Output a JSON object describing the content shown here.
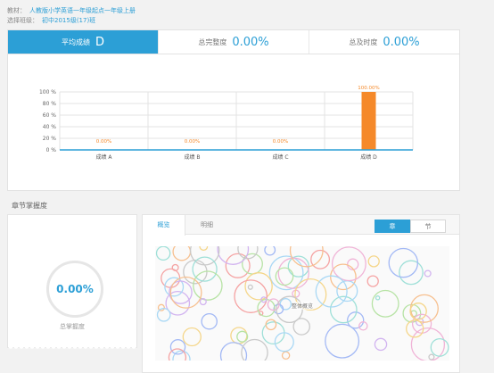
{
  "header": {
    "textbook_label": "教材：",
    "textbook_value": "人教版小学英语一年级起点一年级上册",
    "class_label": "选择班级：",
    "class_value": "初中2015级(17)班"
  },
  "summary": {
    "avg_label": "平均成绩",
    "avg_value": "D",
    "completion_label": "总完整度",
    "completion_value": "0.00%",
    "ontime_label": "总及时度",
    "ontime_value": "0.00%"
  },
  "chart_data": {
    "type": "bar",
    "categories": [
      "成绩 A",
      "成绩 B",
      "成绩 C",
      "成绩 D"
    ],
    "values": [
      0,
      0,
      0,
      100
    ],
    "data_labels": [
      "0.00%",
      "0.00%",
      "0.00%",
      "100.00%"
    ],
    "ylim": [
      0,
      100
    ],
    "yticks": [
      "0 %",
      "20 %",
      "40 %",
      "60 %",
      "80 %",
      "100 %"
    ],
    "grid": true,
    "bar_color": "#f5892a",
    "label_color": "#f5892a",
    "axis_color": "#2c9fd6"
  },
  "section_title": "章节掌握度",
  "mastery": {
    "value": "0.00%",
    "label": "总掌握度"
  },
  "tabs": [
    "概览",
    "明细"
  ],
  "segment": {
    "options": [
      "章",
      "节"
    ],
    "active": 0
  },
  "bubble_label": "整体概览",
  "colors": {
    "accent": "#2c9fd6",
    "bar": "#f5892a"
  }
}
